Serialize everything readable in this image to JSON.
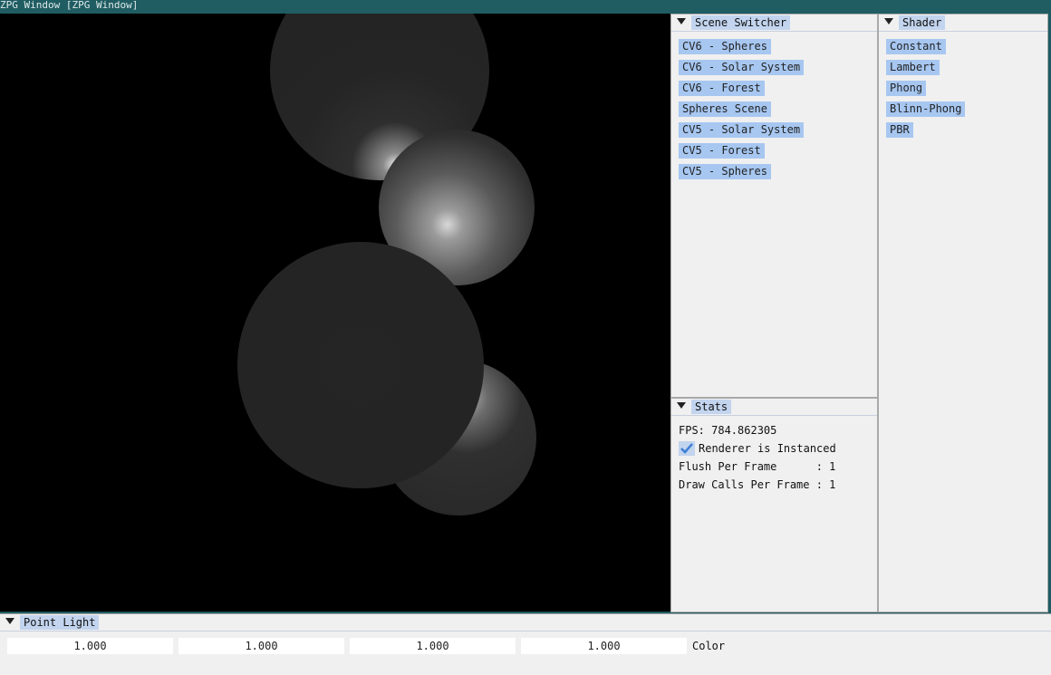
{
  "window": {
    "title": "ZPG Window [ZPG Window]"
  },
  "scene_switcher": {
    "title": "Scene Switcher",
    "buttons": [
      "CV6 - Spheres",
      "CV6 - Solar System",
      "CV6 - Forest",
      "Spheres Scene",
      "CV5 - Solar System",
      "CV5 - Forest",
      "CV5 - Spheres"
    ]
  },
  "shader": {
    "title": "Shader",
    "buttons": [
      "Constant",
      "Lambert",
      "Phong",
      "Blinn-Phong",
      "PBR"
    ]
  },
  "stats": {
    "title": "Stats",
    "fps": "FPS: 784.862305",
    "renderer_instanced_label": "Renderer is Instanced",
    "renderer_instanced_checked": true,
    "flush_per_frame": "Flush Per Frame      : 1",
    "draw_calls_per_frame": "Draw Calls Per Frame : 1"
  },
  "point_light": {
    "title": "Point Light",
    "values": [
      "1.000",
      "1.000",
      "1.000",
      "1.000"
    ],
    "label": "Color"
  },
  "colors": {
    "button_bg": "#a7c7f1",
    "header_bg": "#c2d4ee",
    "panel_bg": "#f0f0f0",
    "viewport_bg": "#000000",
    "check_color": "#3f7fd6"
  }
}
